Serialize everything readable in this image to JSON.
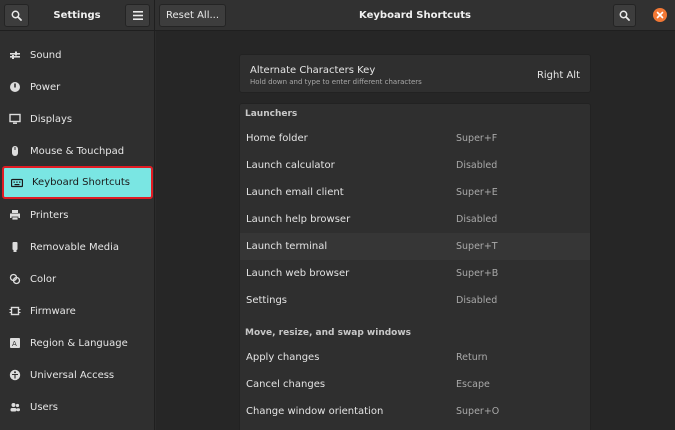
{
  "sidebar_header": {
    "title": "Settings"
  },
  "header": {
    "reset_label": "Reset All...",
    "title": "Keyboard Shortcuts"
  },
  "sidebar": {
    "items": [
      {
        "label": "Sound",
        "icon": "speaker-icon"
      },
      {
        "label": "Power",
        "icon": "power-icon"
      },
      {
        "label": "Displays",
        "icon": "display-icon"
      },
      {
        "label": "Mouse & Touchpad",
        "icon": "mouse-icon"
      },
      {
        "label": "Keyboard Shortcuts",
        "icon": "keyboard-icon",
        "selected": true
      },
      {
        "label": "Printers",
        "icon": "printer-icon"
      },
      {
        "label": "Removable Media",
        "icon": "usb-icon"
      },
      {
        "label": "Color",
        "icon": "color-icon"
      },
      {
        "label": "Firmware",
        "icon": "chip-icon"
      },
      {
        "label": "Region & Language",
        "icon": "region-icon"
      },
      {
        "label": "Universal Access",
        "icon": "accessibility-icon"
      },
      {
        "label": "Users",
        "icon": "users-icon"
      }
    ]
  },
  "alternate": {
    "title": "Alternate Characters Key",
    "subtitle": "Hold down and type to enter different characters",
    "value": "Right Alt"
  },
  "launchers": {
    "heading": "Launchers",
    "rows": [
      {
        "name": "Home folder",
        "accel": "Super+F"
      },
      {
        "name": "Launch calculator",
        "accel": "Disabled"
      },
      {
        "name": "Launch email client",
        "accel": "Super+E"
      },
      {
        "name": "Launch help browser",
        "accel": "Disabled"
      },
      {
        "name": "Launch terminal",
        "accel": "Super+T"
      },
      {
        "name": "Launch web browser",
        "accel": "Super+B"
      },
      {
        "name": "Settings",
        "accel": "Disabled"
      }
    ]
  },
  "windows": {
    "heading": "Move, resize, and swap windows",
    "rows": [
      {
        "name": "Apply changes",
        "accel": "Return"
      },
      {
        "name": "Cancel changes",
        "accel": "Escape"
      },
      {
        "name": "Change window orientation",
        "accel": "Super+O"
      }
    ]
  },
  "colors": {
    "selected_bg": "#7ae6e3",
    "selection_outline": "#e01c24",
    "close_button": "#f27835"
  }
}
